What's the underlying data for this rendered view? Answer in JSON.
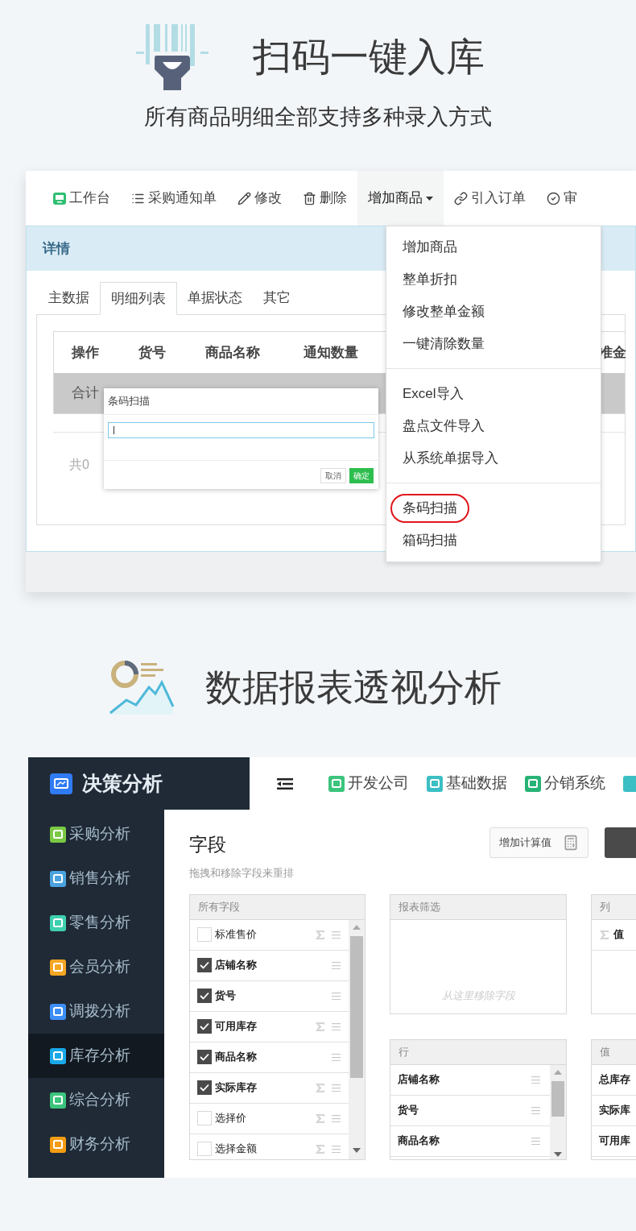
{
  "section1": {
    "title": "扫码一键入库",
    "subtitle": "所有商品明细全部支持多种录入方式"
  },
  "toolbar": [
    {
      "label": "工作台",
      "kind": "workbench",
      "selected": false
    },
    {
      "label": "采购通知单",
      "kind": "list",
      "selected": false
    },
    {
      "label": "修改",
      "kind": "edit",
      "selected": false
    },
    {
      "label": "删除",
      "kind": "delete",
      "selected": false
    },
    {
      "label": "增加商品",
      "kind": "dropdown",
      "selected": true
    },
    {
      "label": "引入订单",
      "kind": "link",
      "selected": false
    },
    {
      "label": "审",
      "kind": "approve",
      "selected": false
    }
  ],
  "detail": {
    "title": "详情",
    "tabs": [
      {
        "label": "主数据",
        "selected": false
      },
      {
        "label": "明细列表",
        "selected": true
      },
      {
        "label": "单据状态",
        "selected": false
      },
      {
        "label": "其它",
        "selected": false
      }
    ],
    "columns": [
      "操作",
      "货号",
      "商品名称",
      "通知数量",
      "准金"
    ],
    "total_label": "合计",
    "footer": "共0"
  },
  "scan_dialog": {
    "title": "条码扫描",
    "buttons": [
      {
        "label": "取消",
        "kind": "cancel"
      },
      {
        "label": "确定",
        "kind": "confirm"
      }
    ]
  },
  "dropdown": {
    "groups": [
      {
        "items": [
          {
            "label": "增加商品",
            "circled": false
          },
          {
            "label": "整单折扣",
            "circled": false
          },
          {
            "label": "修改整单金额",
            "circled": false
          },
          {
            "label": "一键清除数量",
            "circled": false
          }
        ]
      },
      {
        "items": [
          {
            "label": "Excel导入",
            "circled": false
          },
          {
            "label": "盘点文件导入",
            "circled": false
          },
          {
            "label": "从系统单据导入",
            "circled": false
          }
        ]
      },
      {
        "items": [
          {
            "label": "条码扫描",
            "circled": true
          },
          {
            "label": "箱码扫描",
            "circled": false
          }
        ]
      }
    ]
  },
  "section2": {
    "title": "数据报表透视分析"
  },
  "app": {
    "brand": "决策分析",
    "top_nav": [
      {
        "label": "开发公司",
        "color": "#3cc47c"
      },
      {
        "label": "基础数据",
        "color": "#3bbfc4"
      },
      {
        "label": "分销系统",
        "color": "#27b376"
      }
    ],
    "sidebar": [
      {
        "label": "采购分析",
        "color": "#7ac943",
        "selected": false
      },
      {
        "label": "销售分析",
        "color": "#4aa3df",
        "selected": false
      },
      {
        "label": "零售分析",
        "color": "#3ecfb0",
        "selected": false
      },
      {
        "label": "会员分析",
        "color": "#f5a623",
        "selected": false
      },
      {
        "label": "调拨分析",
        "color": "#3d8ef7",
        "selected": false
      },
      {
        "label": "库存分析",
        "color": "#1aa9e8",
        "selected": true
      },
      {
        "label": "综合分析",
        "color": "#3cc47c",
        "selected": false
      },
      {
        "label": "财务分析",
        "color": "#f39c12",
        "selected": false
      }
    ],
    "fields_title": "字段",
    "fields_hint": "拖拽和移除字段来重排",
    "calc_button": "增加计算值",
    "all_fields": {
      "title": "所有字段",
      "items": [
        {
          "label": "标准售价",
          "checked": false,
          "sigma": true
        },
        {
          "label": "店铺名称",
          "checked": true,
          "sigma": false
        },
        {
          "label": "货号",
          "checked": true,
          "sigma": false
        },
        {
          "label": "可用库存",
          "checked": true,
          "sigma": true
        },
        {
          "label": "商品名称",
          "checked": true,
          "sigma": false
        },
        {
          "label": "实际库存",
          "checked": true,
          "sigma": true
        },
        {
          "label": "选择价",
          "checked": false,
          "sigma": true
        },
        {
          "label": "选择金额",
          "checked": false,
          "sigma": true
        }
      ]
    },
    "filter": {
      "title": "报表筛选",
      "placeholder": "从这里移除字段"
    },
    "columns": {
      "title": "列",
      "items": [
        {
          "label": "值",
          "sigma": true
        }
      ]
    },
    "rows": {
      "title": "行",
      "items": [
        {
          "label": "店铺名称"
        },
        {
          "label": "货号"
        },
        {
          "label": "商品名称"
        }
      ]
    },
    "values": {
      "title": "值",
      "items": [
        {
          "label": "总库存"
        },
        {
          "label": "实际库"
        },
        {
          "label": "可用库"
        }
      ]
    }
  }
}
